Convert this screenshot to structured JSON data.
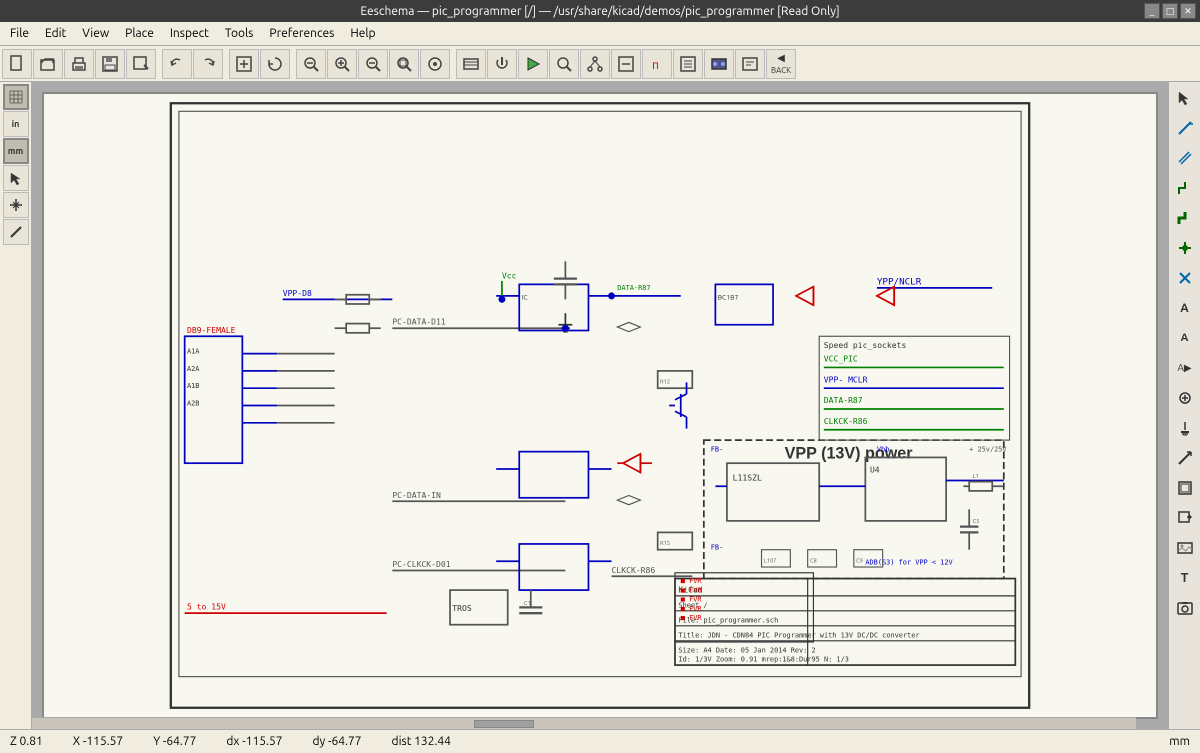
{
  "titlebar": {
    "title": "Eeschema — pic_programmer [/] — /usr/share/kicad/demos/pic_programmer [Read Only]"
  },
  "menubar": {
    "items": [
      "File",
      "Edit",
      "View",
      "Place",
      "Inspect",
      "Tools",
      "Preferences",
      "Help"
    ]
  },
  "toolbar": {
    "buttons": [
      {
        "name": "new",
        "icon": "📄"
      },
      {
        "name": "open",
        "icon": "📂"
      },
      {
        "name": "print",
        "icon": "🖨"
      },
      {
        "name": "save",
        "icon": "💾"
      },
      {
        "name": "save-as",
        "icon": "📋"
      },
      {
        "name": "sep1",
        "icon": ""
      },
      {
        "name": "undo",
        "icon": "↩"
      },
      {
        "name": "redo",
        "icon": "↪"
      },
      {
        "name": "sep2",
        "icon": ""
      },
      {
        "name": "zoom-fit",
        "icon": "⊞"
      },
      {
        "name": "refresh",
        "icon": "⟳"
      },
      {
        "name": "sep3",
        "icon": ""
      },
      {
        "name": "zoom-prev",
        "icon": "←"
      },
      {
        "name": "zoom-in",
        "icon": "⊕"
      },
      {
        "name": "zoom-out",
        "icon": "⊖"
      },
      {
        "name": "zoom-area",
        "icon": "⊡"
      },
      {
        "name": "zoom-center",
        "icon": "⊠"
      },
      {
        "name": "sep4",
        "icon": ""
      },
      {
        "name": "sym-lib",
        "icon": "≡"
      },
      {
        "name": "power",
        "icon": "⚡"
      },
      {
        "name": "sim",
        "icon": "▶"
      },
      {
        "name": "inspect",
        "icon": "🔍"
      },
      {
        "name": "net",
        "icon": "🔗"
      },
      {
        "name": "edit-sym",
        "icon": "✏"
      },
      {
        "name": "pi",
        "icon": "π"
      },
      {
        "name": "bom",
        "icon": "📊"
      },
      {
        "name": "pcb",
        "icon": "⬛"
      },
      {
        "name": "netlist",
        "icon": "📋"
      },
      {
        "name": "back",
        "icon": "◀"
      }
    ]
  },
  "left_sidebar": {
    "buttons": [
      {
        "name": "grid-toggle",
        "icon": "⊞",
        "active": true
      },
      {
        "name": "unit-in",
        "icon": "in"
      },
      {
        "name": "unit-mm",
        "icon": "mm",
        "active": true
      },
      {
        "name": "cursor",
        "icon": "↖"
      },
      {
        "name": "cross-probe",
        "icon": "+"
      },
      {
        "name": "add-wire",
        "icon": "/"
      }
    ]
  },
  "right_sidebar": {
    "buttons": [
      {
        "name": "select",
        "icon": "↖"
      },
      {
        "name": "arrow-right",
        "icon": "→"
      },
      {
        "name": "arrow-down",
        "icon": "↓"
      },
      {
        "name": "wire",
        "icon": "╱"
      },
      {
        "name": "bus",
        "icon": "╱"
      },
      {
        "name": "junction",
        "icon": "•"
      },
      {
        "name": "no-connect",
        "icon": "✕"
      },
      {
        "name": "net-label",
        "icon": "A"
      },
      {
        "name": "global-label",
        "icon": "A"
      },
      {
        "name": "hier-label",
        "icon": "A▶"
      },
      {
        "name": "add-symbol",
        "icon": "O"
      },
      {
        "name": "add-power",
        "icon": "⏚"
      },
      {
        "name": "draw-wire",
        "icon": "╱"
      },
      {
        "name": "add-sheet",
        "icon": "□"
      },
      {
        "name": "import-sheet",
        "icon": "□↓"
      },
      {
        "name": "add-image",
        "icon": "🖼"
      },
      {
        "name": "add-text",
        "icon": "T"
      },
      {
        "name": "camera",
        "icon": "📷"
      }
    ]
  },
  "statusbar": {
    "zoom": "Z 0.81",
    "x": "X -115.57",
    "y": "Y -64.77",
    "dx": "dx -115.57",
    "dy": "dy -64.77",
    "dist": "dist 132.44",
    "unit": "mm"
  },
  "schematic": {
    "title": "VPP (13V) power",
    "sheet_title": "Title: JDN - CDN84 PIC Programmer with 13V DC/DC converter"
  }
}
